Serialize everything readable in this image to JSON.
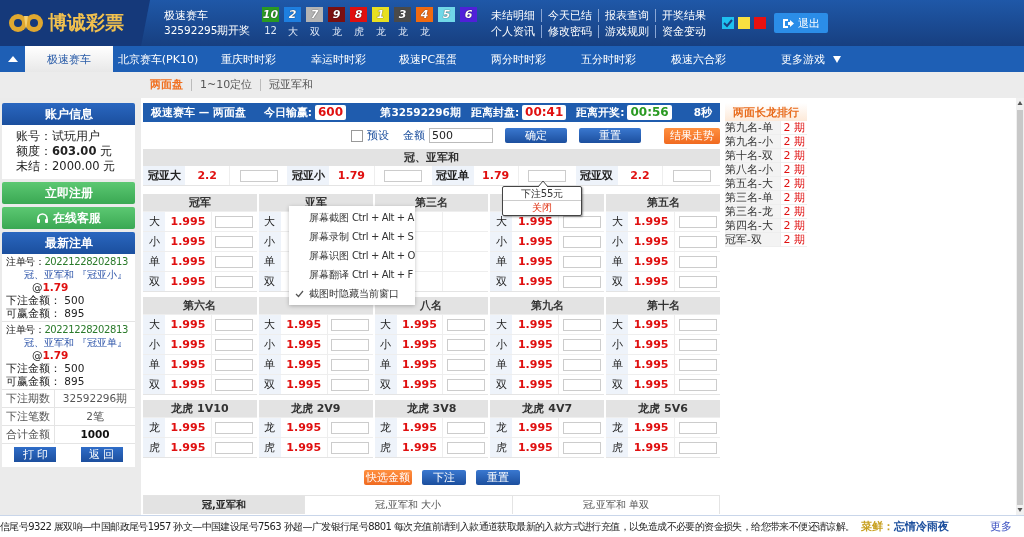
{
  "header": {
    "logo": "博诚彩票",
    "game": "极速赛车",
    "draw": "32592295期开奖",
    "balls": [
      {
        "number": "10",
        "color": "#2a9a22"
      },
      {
        "number": "2",
        "color": "#1e7fe0"
      },
      {
        "number": "7",
        "color": "#b4b4b4"
      },
      {
        "number": "9",
        "color": "#7a1010"
      },
      {
        "number": "8",
        "color": "#e01010"
      },
      {
        "number": "1",
        "color": "#e8e020"
      },
      {
        "number": "3",
        "color": "#4a4a4a"
      },
      {
        "number": "4",
        "color": "#f06a10"
      },
      {
        "number": "5",
        "color": "#70d8e8"
      },
      {
        "number": "6",
        "color": "#5020d8"
      }
    ],
    "stats": [
      "12",
      "大",
      "双",
      "龙",
      "虎",
      "龙",
      "龙",
      "龙"
    ],
    "links": [
      [
        "未结明细",
        "今天已结",
        "报表查询",
        "开奖结果"
      ],
      [
        "个人资讯",
        "修改密码",
        "游戏规则",
        "资金变动"
      ]
    ],
    "themes": [
      {
        "color": "#1ec0f0",
        "selected": true
      },
      {
        "color": "#f8e040",
        "selected": false
      },
      {
        "color": "#e81010",
        "selected": false
      }
    ],
    "logout": "退出"
  },
  "nav": {
    "tabs": [
      {
        "label": "极速赛车",
        "selected": true
      },
      {
        "label": "北京赛车(PK10)",
        "selected": false
      },
      {
        "label": "重庆时时彩",
        "selected": false
      },
      {
        "label": "幸运时时彩",
        "selected": false
      },
      {
        "label": "极速PC蛋蛋",
        "selected": false
      },
      {
        "label": "两分时时彩",
        "selected": false
      },
      {
        "label": "五分时时彩",
        "selected": false
      },
      {
        "label": "极速六合彩",
        "selected": false
      }
    ],
    "more": "更多游戏"
  },
  "subnav": [
    {
      "label": "两面盘",
      "selected": true
    },
    {
      "label": "1~10定位",
      "selected": false
    },
    {
      "label": "冠亚军和",
      "selected": false
    }
  ],
  "account": {
    "title": "账户信息",
    "fields": [
      "账号：试玩用户",
      "额度：**603.00** 元",
      "未结：2000.00 元"
    ]
  },
  "register": "立即注册",
  "service": "在线客服",
  "recent": {
    "title": "最新注单",
    "bets": [
      {
        "number_label": "注单号：",
        "number": "20221228202813",
        "item": "冠、亚军和 『冠亚小』",
        "at": "@",
        "odds": "1.79",
        "stake": "下注金额：  500",
        "win": "可赢金额：  895"
      },
      {
        "number_label": "注单号：",
        "number": "20221228202813",
        "item": "冠、亚军和 『冠亚单』",
        "at": "@",
        "odds": "1.79",
        "stake": "下注金额：  500",
        "win": "可赢金额：  895"
      }
    ],
    "summary": [
      {
        "label": "下注期数",
        "value": "32592296期",
        "emphasis": false
      },
      {
        "label": "下注笔数",
        "value": "2笔",
        "emphasis": false
      },
      {
        "label": "合计金额",
        "value": "1000",
        "emphasis": true
      }
    ],
    "buttons": [
      "打 印",
      "返 回"
    ]
  },
  "board": {
    "bar": {
      "title": "极速赛车 — 两面盘",
      "profit_label": "今日输赢:",
      "profit": "600",
      "period": "第32592296期",
      "close_label": "距离封盘:",
      "close": "00:41",
      "open_label": "距离开奖:",
      "open": "00:56",
      "refresh": "8秒"
    },
    "controls": {
      "preset": {
        "label": "预设",
        "checked": false
      },
      "amount_label": "金额",
      "amount": "500",
      "confirm": "确定",
      "reset": "重置",
      "trend": "结果走势"
    },
    "sum": {
      "title": "冠、亚军和",
      "items": [
        {
          "label": "冠亚大",
          "odds": "2.2"
        },
        {
          "label": "冠亚小",
          "odds": "1.79"
        },
        {
          "label": "冠亚单",
          "odds": "1.79"
        },
        {
          "label": "冠亚双",
          "odds": "2.2"
        }
      ]
    },
    "sections": [
      {
        "groups": [
          {
            "title": "冠军",
            "rows": [
              {
                "label": "大",
                "odds": "1.995"
              },
              {
                "label": "小",
                "odds": "1.995"
              },
              {
                "label": "单",
                "odds": "1.995"
              },
              {
                "label": "双",
                "odds": "1.995"
              }
            ]
          },
          {
            "title": "亚军",
            "rows": [
              {
                "label": "大"
              },
              {
                "label": "小"
              },
              {
                "label": "单"
              },
              {
                "label": "双"
              }
            ]
          },
          {
            "title": "第三名",
            "rows": [
              {},
              {},
              {},
              {}
            ]
          },
          {
            "rows": [
              {
                "label": "大",
                "odds": "1.995"
              },
              {
                "label": "小",
                "odds": "1.995"
              },
              {
                "label": "单",
                "odds": "1.995"
              },
              {
                "label": "双",
                "odds": "1.995"
              }
            ]
          },
          {
            "title": "第五名",
            "rows": [
              {
                "label": "大",
                "odds": "1.995"
              },
              {
                "label": "小",
                "odds": "1.995"
              },
              {
                "label": "单",
                "odds": "1.995"
              },
              {
                "label": "双",
                "odds": "1.995"
              }
            ]
          }
        ]
      },
      {
        "groups": [
          {
            "title": "第六名",
            "rows": [
              {
                "label": "大",
                "odds": "1.995"
              },
              {
                "label": "小",
                "odds": "1.995"
              },
              {
                "label": "单",
                "odds": "1.995"
              },
              {
                "label": "双",
                "odds": "1.995"
              }
            ]
          },
          {
            "rows": [
              {
                "label": "大",
                "odds": "1.995"
              },
              {
                "label": "小",
                "odds": "1.995"
              },
              {
                "label": "单",
                "odds": "1.995"
              },
              {
                "label": "双",
                "odds": "1.995"
              }
            ]
          },
          {
            "title": "八名",
            "rows": [
              {
                "label": "大",
                "odds": "1.995"
              },
              {
                "label": "小",
                "odds": "1.995"
              },
              {
                "label": "单",
                "odds": "1.995"
              },
              {
                "label": "双",
                "odds": "1.995"
              }
            ]
          },
          {
            "title": "第九名",
            "rows": [
              {
                "label": "大",
                "odds": "1.995"
              },
              {
                "label": "小",
                "odds": "1.995"
              },
              {
                "label": "单",
                "odds": "1.995"
              },
              {
                "label": "双",
                "odds": "1.995"
              }
            ]
          },
          {
            "title": "第十名",
            "rows": [
              {
                "label": "大",
                "odds": "1.995"
              },
              {
                "label": "小",
                "odds": "1.995"
              },
              {
                "label": "单",
                "odds": "1.995"
              },
              {
                "label": "双",
                "odds": "1.995"
              }
            ]
          }
        ]
      },
      {
        "groups": [
          {
            "title": "龙虎 1V10",
            "rows": [
              {
                "label": "龙",
                "odds": "1.995"
              },
              {
                "label": "虎",
                "odds": "1.995"
              }
            ]
          },
          {
            "title": "龙虎 2V9",
            "rows": [
              {
                "label": "龙",
                "odds": "1.995"
              },
              {
                "label": "虎",
                "odds": "1.995"
              }
            ]
          },
          {
            "title": "龙虎 3V8",
            "rows": [
              {
                "label": "龙",
                "odds": "1.995"
              },
              {
                "label": "虎",
                "odds": "1.995"
              }
            ]
          },
          {
            "title": "龙虎 4V7",
            "rows": [
              {
                "label": "龙",
                "odds": "1.995"
              },
              {
                "label": "虎",
                "odds": "1.995"
              }
            ]
          },
          {
            "title": "龙虎 5V6",
            "rows": [
              {
                "label": "龙",
                "odds": "1.995"
              },
              {
                "label": "虎",
                "odds": "1.995"
              }
            ]
          }
        ]
      }
    ],
    "actions": [
      {
        "label": "快选金额",
        "kind": "quick"
      },
      {
        "label": "下注",
        "kind": "submit"
      },
      {
        "label": "重置",
        "kind": "reset"
      }
    ],
    "bottom_tabs": [
      {
        "label": "冠,亚军和",
        "selected": true
      },
      {
        "label": "冠,亚军和 大小",
        "selected": false
      },
      {
        "label": "冠,亚军和 单双",
        "selected": false
      }
    ],
    "tooltip": {
      "text": "下注55元",
      "close": "关闭"
    },
    "context_menu": {
      "items": [
        {
          "label": "屏幕截图",
          "shortcut": "Ctrl + Alt + A"
        },
        {
          "label": "屏幕录制",
          "shortcut": "Ctrl + Alt + S"
        },
        {
          "label": "屏幕识图",
          "shortcut": "Ctrl + Alt + O"
        },
        {
          "label": "屏幕翻译",
          "shortcut": "Ctrl + Alt + F"
        }
      ],
      "toggle": {
        "label": "截图时隐藏当前窗口",
        "checked": true
      }
    }
  },
  "ranking": {
    "title": "两面长龙排行",
    "rows": [
      {
        "name": "第九名-单",
        "count": "2 期"
      },
      {
        "name": "第九名-小",
        "count": "2 期"
      },
      {
        "name": "第十名-双",
        "count": "2 期"
      },
      {
        "name": "第八名-小",
        "count": "2 期"
      },
      {
        "name": "第五名-大",
        "count": "2 期"
      },
      {
        "name": "第三名-单",
        "count": "2 期"
      },
      {
        "name": "第三名-龙",
        "count": "2 期"
      },
      {
        "name": "第四名-大",
        "count": "2 期"
      },
      {
        "name": "冠军-双",
        "count": "2 期"
      }
    ]
  },
  "footer": {
    "notice": "信尾号9322 展双响—中国邮政尾号1957 孙文—中国建设尾号7563 孙超—广发银行尾号8801 每次充值前请到入款通道获取最新的入款方式进行充值，以免造成不必要的资金损失，给您带来不便还请谅解。",
    "signer_label": "菜鲜：",
    "signer": "忘情冷雨夜",
    "more": "更多"
  }
}
